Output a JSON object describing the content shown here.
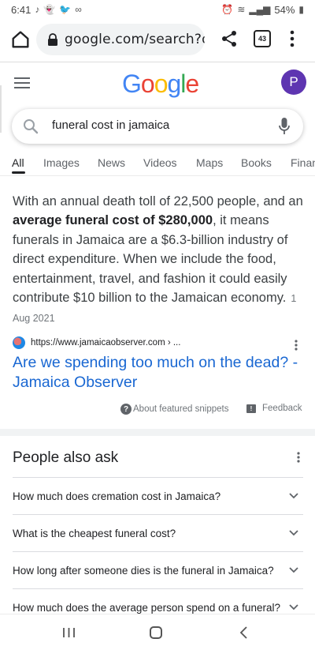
{
  "status_bar": {
    "time": "6:41",
    "battery": "54%"
  },
  "browser": {
    "url": "google.com/search?q=",
    "tab_count": "43"
  },
  "google": {
    "logo_letters": [
      {
        "ch": "G",
        "color": "#4285F4"
      },
      {
        "ch": "o",
        "color": "#EA4335"
      },
      {
        "ch": "o",
        "color": "#FBBC05"
      },
      {
        "ch": "g",
        "color": "#4285F4"
      },
      {
        "ch": "l",
        "color": "#34A853"
      },
      {
        "ch": "e",
        "color": "#EA4335"
      }
    ],
    "avatar_letter": "P"
  },
  "search": {
    "query": "funeral cost in jamaica"
  },
  "tabs": [
    "All",
    "Images",
    "News",
    "Videos",
    "Maps",
    "Books",
    "Finance"
  ],
  "snippet": {
    "text_before": "With an annual death toll of 22,500 people, and an ",
    "bold": "average funeral cost of $280,000",
    "text_after": ", it means funerals in Jamaica are a $6.3-billion industry of direct expenditure. When we include the food, entertainment, travel, and fashion it could easily contribute $10 billion to the Jamaican economy.",
    "date": "1 Aug 2021",
    "source_url": "https://www.jamaicaobserver.com › ...",
    "title": "Are we spending too much on the dead? - Jamaica Observer",
    "about_label": "About featured snippets",
    "feedback_label": "Feedback"
  },
  "people_also_ask": {
    "title": "People also ask",
    "questions": [
      "How much does cremation cost in Jamaica?",
      "What is the cheapest funeral cost?",
      "How long after someone dies is the funeral in Jamaica?",
      "How much does the average person spend on a funeral?"
    ]
  },
  "colors": {
    "link": "#1967d2",
    "avatar_bg": "#5e35b1"
  }
}
